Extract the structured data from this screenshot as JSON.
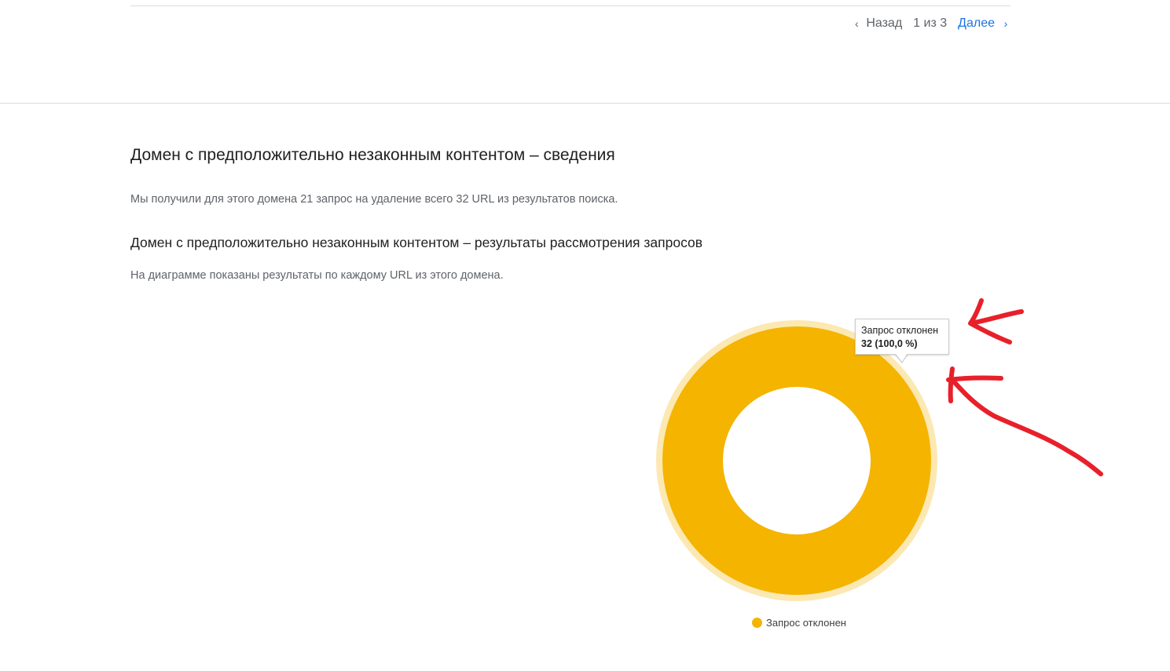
{
  "pagination": {
    "prev_label": "Назад",
    "page_status": "1 из 3",
    "next_label": "Далее"
  },
  "section": {
    "title": "Домен с предположительно незаконным контентом – сведения",
    "summary": "Мы получили для этого домена 21 запрос на удаление всего 32 URL из результатов поиска.",
    "results_title": "Домен с предположительно незаконным контентом – результаты рассмотрения запросов",
    "results_description": "На диаграмме показаны результаты по каждому URL из этого домена."
  },
  "tooltip": {
    "label": "Запрос отклонен",
    "value": "32 (100,0 %)"
  },
  "chart_data": {
    "type": "pie",
    "donut": true,
    "categories": [
      "Запрос отклонен"
    ],
    "values": [
      32
    ],
    "percentages": [
      100.0
    ],
    "colors": [
      "#f4b400"
    ],
    "legend_position": "bottom"
  },
  "legend": {
    "items": [
      {
        "label": "Запрос отклонен",
        "color": "#f4b400"
      }
    ]
  },
  "annotation": {
    "color": "#e8202a"
  }
}
